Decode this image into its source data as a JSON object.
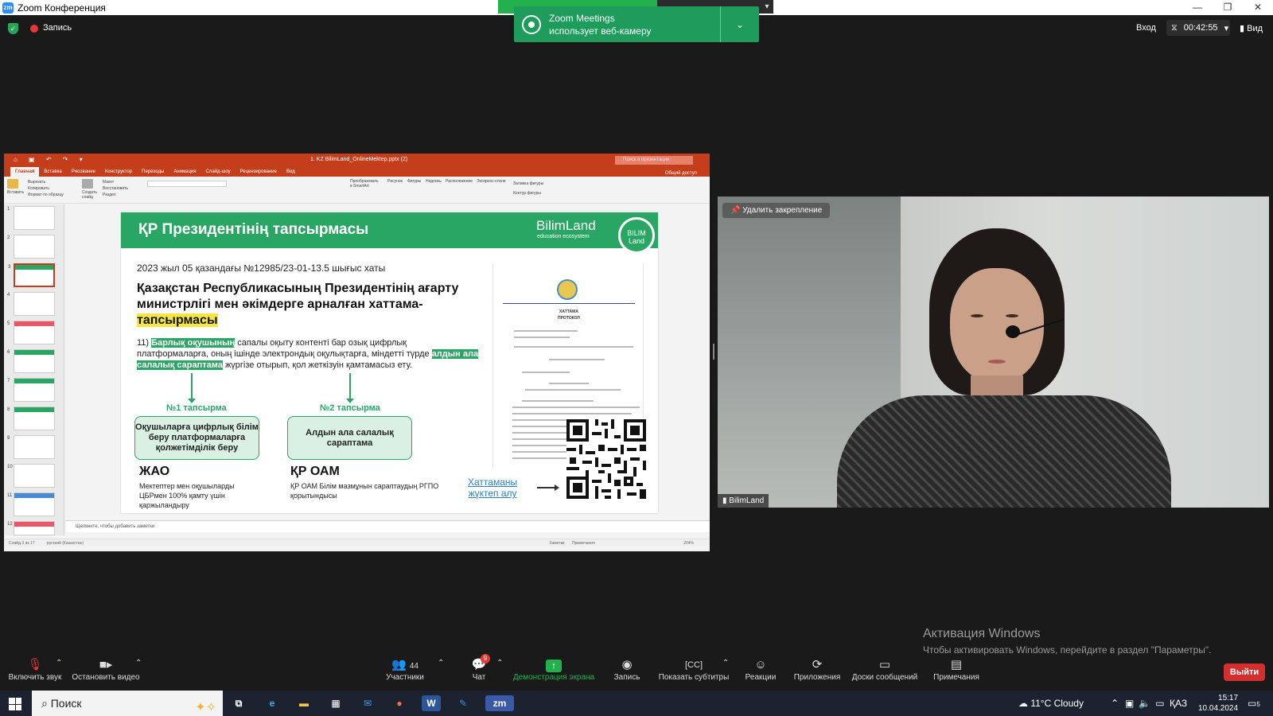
{
  "window": {
    "title": "Zoom Конференция",
    "controls": [
      "—",
      "❐",
      "✕"
    ]
  },
  "topbar": {
    "recording": "Запись",
    "enter": "Вход",
    "timer": "00:42:55",
    "view": "Вид"
  },
  "camera_notice": {
    "line1": "Zoom Meetings",
    "line2": "использует веб-камеру"
  },
  "ppt": {
    "filename": "1. KZ BilimLand_OnlineMektep.pptx (2)",
    "search_placeholder": "Поиск в презентации",
    "tabs": [
      "Главная",
      "Вставка",
      "Рисование",
      "Конструктор",
      "Переходы",
      "Анимация",
      "Слайд-шоу",
      "Рецензирование",
      "Вид"
    ],
    "share_access": "Общий доступ",
    "ribbon": {
      "paste": "Вставить",
      "cut": "Вырезать",
      "copy": "Копировать",
      "format": "Формат по образцу",
      "new_slide": "Создать слайд",
      "layout": "Макет",
      "reset": "Восстановить",
      "section": "Раздел",
      "smartart": "Преобразовать в SmartArt",
      "picture": "Рисунок",
      "shapes": "Фигуры",
      "textbox": "Надпись",
      "arrange": "Расположение",
      "quick_styles": "Экспресс-стили",
      "fill": "Заливка фигуры",
      "outline": "Контур фигуры"
    },
    "thumb_numbers": [
      "1",
      "2",
      "3",
      "4",
      "5",
      "6",
      "7",
      "8",
      "9",
      "10",
      "11",
      "12"
    ],
    "notes_placeholder": "Щелкните, чтобы добавить заметки",
    "status_left": "Слайд 3 из 17",
    "status_lang": "русский (Казахстан)",
    "status_notes": "Заметки",
    "status_comments": "Примечания",
    "zoom": "204%"
  },
  "slide": {
    "title": "ҚР Президентінің тапсырмасы",
    "brand": "BilimLand",
    "brand_sub": "education ecosystem",
    "badge_line1": "BILIM",
    "badge_line2": "Land",
    "date_line": "2023 жыл 05 қазандағы  №12985/23-01-13.5 шығыс хаты",
    "heading_a": "Қазақстан Республикасының Президентінің ағарту министрлігі мен әкімдерге арналған хаттама-",
    "heading_b": "тапсырмасы",
    "p_num": "11) ",
    "p_hl1": "Барлық оқушының",
    "p_mid": " сапалы оқыту контенті бар озық цифрлық платформаларға, оның ішінде электрондық оқулықтарға, міндетті түрде ",
    "p_hl2": "алдын ала салалық сараптама",
    "p_end": " жүргізе отырып, қол жеткізуін қамтамасыз ету.",
    "task1_label": "№1 тапсырма",
    "task2_label": "№2 тапсырма",
    "task1_box": "Оқушыларға цифрлық білім беру платформаларға қолжетімділік беру",
    "task2_box": "Алдын ала салалық сараптама",
    "org1": "ЖАО",
    "org1_sub": "Мектептер мен оқушыларды ЦБРмен 100% қамту үшін қаржыландыру",
    "org2": "ҚР ОАМ",
    "org2_sub": "ҚР ОАМ Білім мазмұнын сараптаудың РГПО қорытындысы",
    "doc_title1": "ХАТТАМА",
    "doc_title2": "ПРОТОКОЛ",
    "link_line1": "Хаттаманы",
    "link_line2": "жүктеп алу"
  },
  "video": {
    "unpin": "Удалить закрепление",
    "name": "BilimLand"
  },
  "activation": {
    "title": "Активация Windows",
    "subtitle": "Чтобы активировать Windows, перейдите в раздел \"Параметры\"."
  },
  "toolbar": {
    "unmute": "Включить звук",
    "stop_video": "Остановить видео",
    "participants": "Участники",
    "participants_count": "44",
    "chat": "Чат",
    "chat_badge": "9",
    "share": "Демонстрация экрана",
    "record": "Запись",
    "captions": "Показать субтитры",
    "reactions": "Реакции",
    "apps": "Приложения",
    "whiteboards": "Доски сообщений",
    "notes": "Примечания",
    "leave": "Выйти"
  },
  "taskbar": {
    "search": "Поиск",
    "weather": "11°C  Cloudy",
    "lang": "ҚАЗ",
    "time": "15:17",
    "date": "10.04.2024",
    "notif_count": "5"
  }
}
